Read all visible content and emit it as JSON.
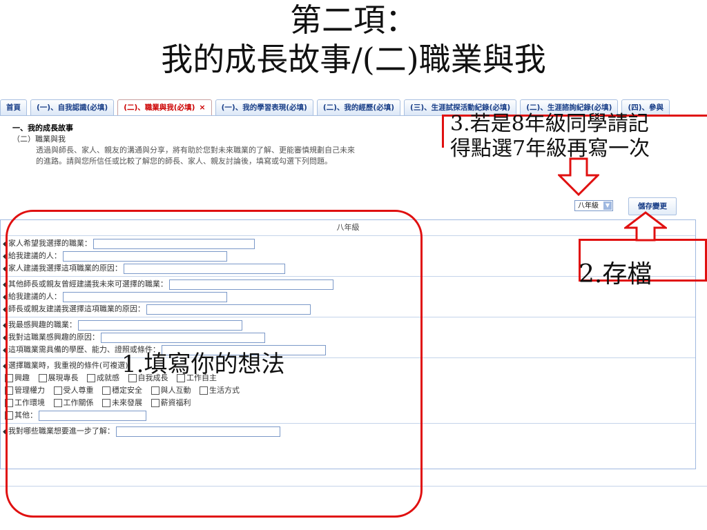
{
  "title": {
    "line1": "第二項：",
    "line2": "我的成長故事/(二)職業與我"
  },
  "tabs": [
    {
      "label": "首頁"
    },
    {
      "label": "(一)、自我認識(必填)"
    },
    {
      "label": "(二)、職業與我(必填)",
      "active": true,
      "close": "×"
    },
    {
      "label": "(一)、我的學習表現(必填)"
    },
    {
      "label": "(二)、我的經歷(必填)"
    },
    {
      "label": "(三)、生涯試探活動紀錄(必填)"
    },
    {
      "label": "(二)、生涯諮詢紀錄(必填)"
    },
    {
      "label": "(四)、參與"
    }
  ],
  "intro": {
    "heading": "一、我的成長故事",
    "subheading": "（二）職業與我",
    "paragraph": "透過與師長、家人、親友的溝通與分享，將有助於您對未來職業的了解、更能審慎規劃自己未來的進路。請與您所信任或比較了解您的師長、家人、親友討論後，填寫或勾選下列問題。"
  },
  "grade_select": {
    "value": "八年級",
    "arrow": "▼"
  },
  "save_button": {
    "label": "儲存變更"
  },
  "form": {
    "header": "八年級",
    "diamond": "◆",
    "family_job": "家人希望我選擇的職業：",
    "family_person": "給我建議的人：",
    "family_reason": "家人建議我選擇這項職業的原因：",
    "other_job": "其他師長或親友曾經建議我未來可選擇的職業：",
    "other_person": "給我建議的人：",
    "other_reason": "師長或親友建議我選擇這項職業的原因：",
    "interest_job": "我最感興趣的職業：",
    "interest_reason": "我對這職業感興趣的原因：",
    "interest_need": "這項職業需具備的學歷、能力、證照或條件：",
    "values_q": "選擇職業時，我重視的條件(可複選)",
    "values_row1": [
      "興趣",
      "展現專長",
      "成就感",
      "自我成長",
      "工作自主"
    ],
    "values_row2": [
      "管理權力",
      "受人尊重",
      "穩定安全",
      "與人互動",
      "生活方式"
    ],
    "values_row3": [
      "工作環境",
      "工作關係",
      "未來發展",
      "薪資福利"
    ],
    "values_other": "其他：",
    "further": "我對哪些職業想要進一步了解："
  },
  "annotations": {
    "step1": "1.填寫你的想法",
    "step2": "2.存檔",
    "step3_line1": "3.若是8年級同學請記",
    "step3_line2": "得點選7年級再寫一次"
  },
  "colors": {
    "annotation_red": "#e01010",
    "tab_blue": "#1a3f88",
    "active_tab_red": "#cc0000"
  }
}
